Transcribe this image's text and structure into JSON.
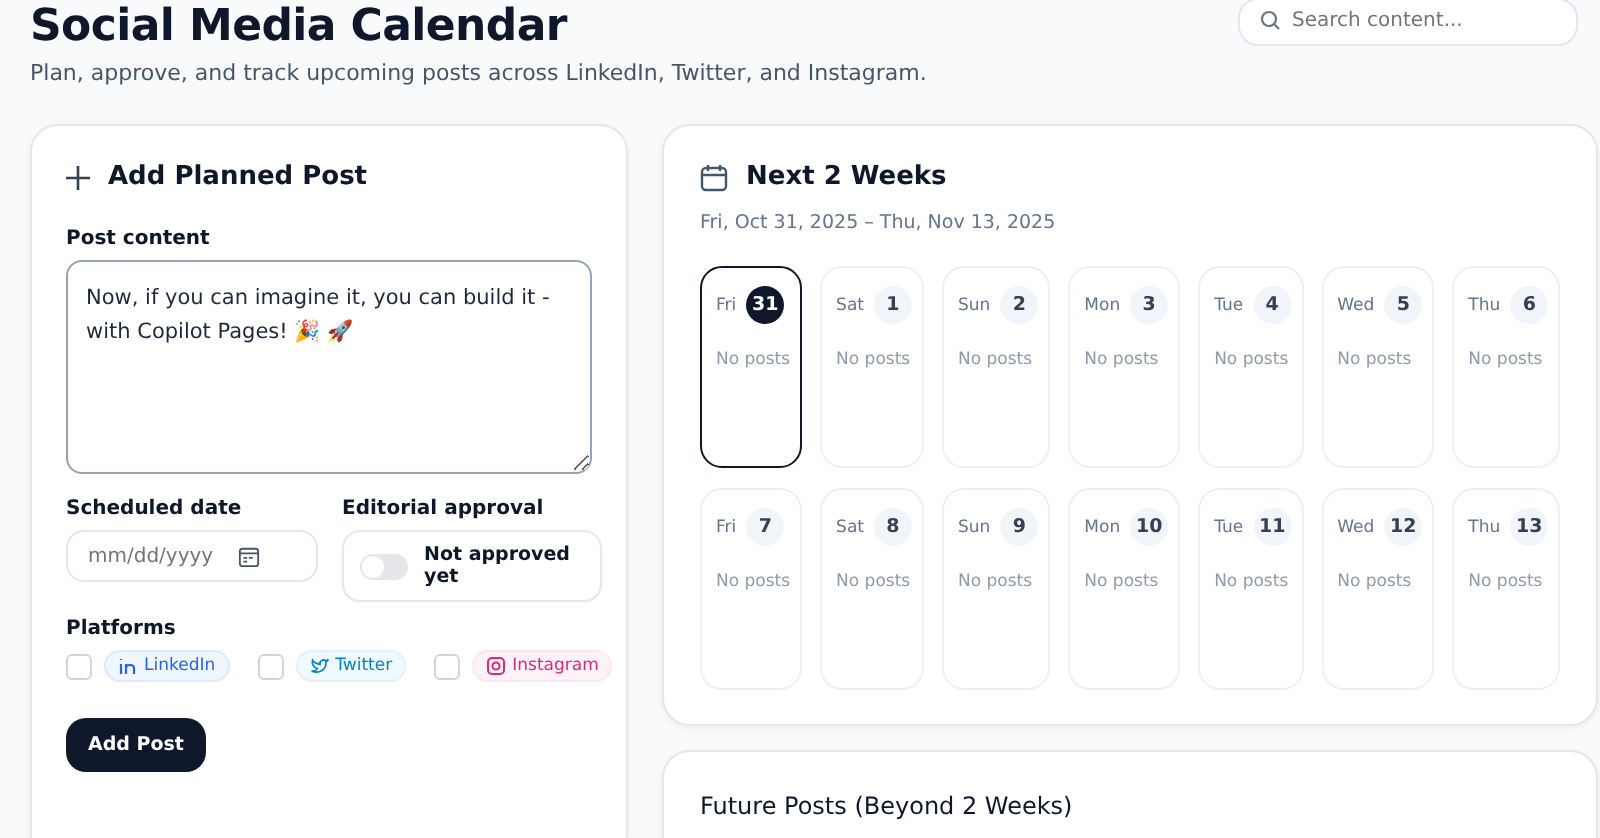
{
  "header": {
    "title": "Social Media Calendar",
    "subtitle": "Plan, approve, and track upcoming posts across LinkedIn, Twitter, and Instagram.",
    "search": {
      "placeholder": "Search content..."
    }
  },
  "form": {
    "title": "Add Planned Post",
    "content_label": "Post content",
    "content_value": "Now, if you can imagine it, you can build it - with Copilot Pages! 🎉 🚀",
    "date_label": "Scheduled date",
    "date_placeholder": "mm/dd/yyyy",
    "approval_label": "Editorial approval",
    "approval": {
      "on": false,
      "text": "Not approved yet"
    },
    "platforms_label": "Platforms",
    "platforms": [
      {
        "kind": "linkedin",
        "label": "LinkedIn",
        "checked": false
      },
      {
        "kind": "twitter",
        "label": "Twitter",
        "checked": false
      },
      {
        "kind": "instagram",
        "label": "Instagram",
        "checked": false
      }
    ],
    "submit": "Add Post"
  },
  "calendar": {
    "title": "Next 2 Weeks",
    "range": "Fri, Oct 31, 2025 – Thu, Nov 13, 2025",
    "days": [
      {
        "weekday": "Fri",
        "date": "31",
        "posts": "No posts",
        "selected": true
      },
      {
        "weekday": "Sat",
        "date": "1",
        "posts": "No posts",
        "selected": false
      },
      {
        "weekday": "Sun",
        "date": "2",
        "posts": "No posts",
        "selected": false
      },
      {
        "weekday": "Mon",
        "date": "3",
        "posts": "No posts",
        "selected": false
      },
      {
        "weekday": "Tue",
        "date": "4",
        "posts": "No posts",
        "selected": false
      },
      {
        "weekday": "Wed",
        "date": "5",
        "posts": "No posts",
        "selected": false
      },
      {
        "weekday": "Thu",
        "date": "6",
        "posts": "No posts",
        "selected": false
      },
      {
        "weekday": "Fri",
        "date": "7",
        "posts": "No posts",
        "selected": false
      },
      {
        "weekday": "Sat",
        "date": "8",
        "posts": "No posts",
        "selected": false
      },
      {
        "weekday": "Sun",
        "date": "9",
        "posts": "No posts",
        "selected": false
      },
      {
        "weekday": "Mon",
        "date": "10",
        "posts": "No posts",
        "selected": false
      },
      {
        "weekday": "Tue",
        "date": "11",
        "posts": "No posts",
        "selected": false
      },
      {
        "weekday": "Wed",
        "date": "12",
        "posts": "No posts",
        "selected": false
      },
      {
        "weekday": "Thu",
        "date": "13",
        "posts": "No posts",
        "selected": false
      }
    ]
  },
  "future": {
    "title": "Future Posts (Beyond 2 Weeks)"
  }
}
